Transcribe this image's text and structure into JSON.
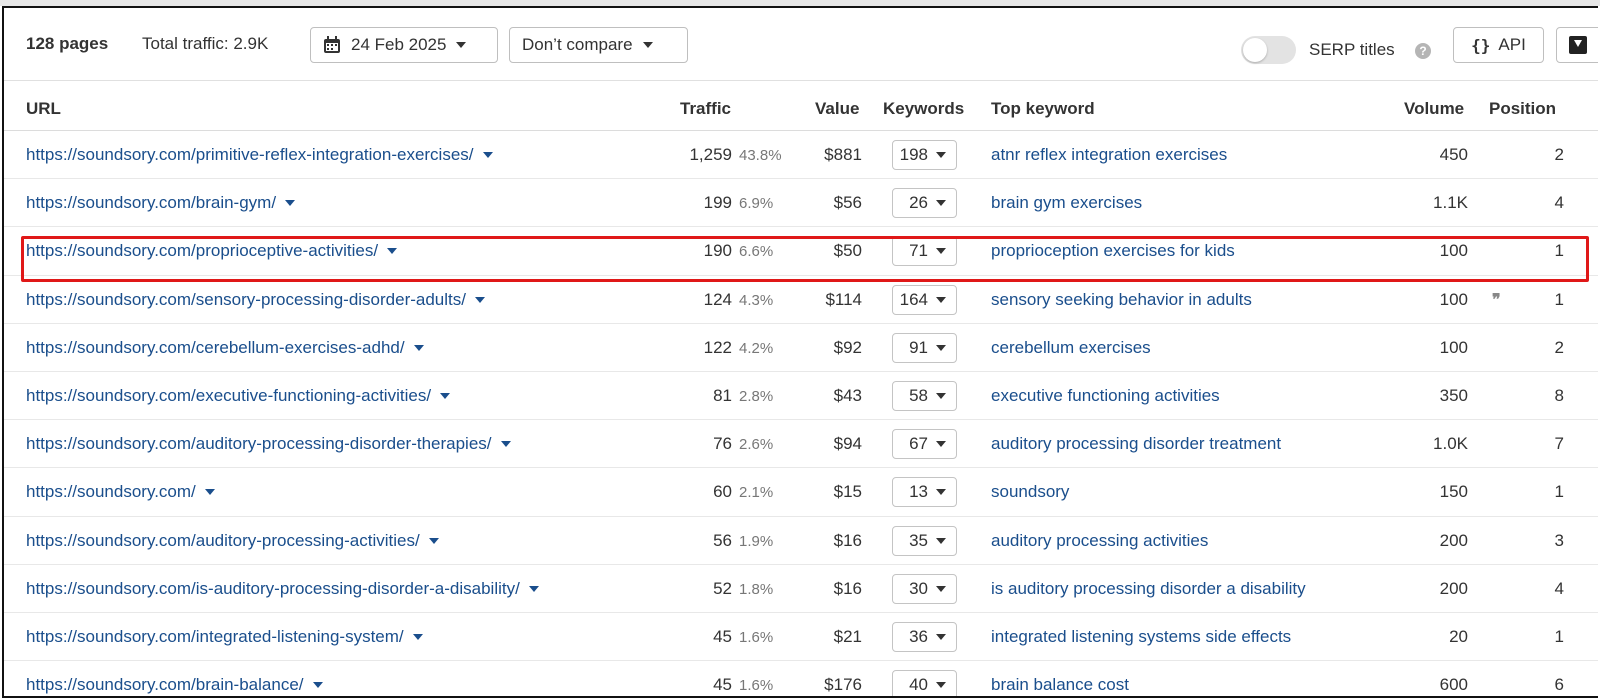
{
  "toolbar": {
    "pages": "128 pages",
    "total_traffic": "Total traffic: 2.9K",
    "date": "24 Feb 2025",
    "compare": "Don’t compare",
    "serp_titles": "SERP titles",
    "help": "?",
    "api_braces": "{}",
    "api": "API"
  },
  "columns": {
    "url": "URL",
    "traffic": "Traffic",
    "value": "Value",
    "keywords": "Keywords",
    "top_keyword": "Top keyword",
    "volume": "Volume",
    "position": "Position"
  },
  "rows": [
    {
      "url": "https://soundsory.com/primitive-reflex-integration-exercises/",
      "traffic": "1,259",
      "pct": "43.8%",
      "value": "$881",
      "keywords": "198",
      "top_keyword": "atnr reflex integration exercises",
      "volume": "450",
      "position": "2"
    },
    {
      "url": "https://soundsory.com/brain-gym/",
      "traffic": "199",
      "pct": "6.9%",
      "value": "$56",
      "keywords": "26",
      "top_keyword": "brain gym exercises",
      "volume": "1.1K",
      "position": "4"
    },
    {
      "url": "https://soundsory.com/proprioceptive-activities/",
      "traffic": "190",
      "pct": "6.6%",
      "value": "$50",
      "keywords": "71",
      "top_keyword": "proprioception exercises for kids",
      "volume": "100",
      "position": "1"
    },
    {
      "url": "https://soundsory.com/sensory-processing-disorder-adults/",
      "traffic": "124",
      "pct": "4.3%",
      "value": "$114",
      "keywords": "164",
      "top_keyword": "sensory seeking behavior in adults",
      "volume": "100",
      "position": "1",
      "quote": "❞"
    },
    {
      "url": "https://soundsory.com/cerebellum-exercises-adhd/",
      "traffic": "122",
      "pct": "4.2%",
      "value": "$92",
      "keywords": "91",
      "top_keyword": "cerebellum exercises",
      "volume": "100",
      "position": "2"
    },
    {
      "url": "https://soundsory.com/executive-functioning-activities/",
      "traffic": "81",
      "pct": "2.8%",
      "value": "$43",
      "keywords": "58",
      "top_keyword": "executive functioning activities",
      "volume": "350",
      "position": "8"
    },
    {
      "url": "https://soundsory.com/auditory-processing-disorder-therapies/",
      "traffic": "76",
      "pct": "2.6%",
      "value": "$94",
      "keywords": "67",
      "top_keyword": "auditory processing disorder treatment",
      "volume": "1.0K",
      "position": "7"
    },
    {
      "url": "https://soundsory.com/",
      "traffic": "60",
      "pct": "2.1%",
      "value": "$15",
      "keywords": "13",
      "top_keyword": "soundsory",
      "volume": "150",
      "position": "1"
    },
    {
      "url": "https://soundsory.com/auditory-processing-activities/",
      "traffic": "56",
      "pct": "1.9%",
      "value": "$16",
      "keywords": "35",
      "top_keyword": "auditory processing activities",
      "volume": "200",
      "position": "3"
    },
    {
      "url": "https://soundsory.com/is-auditory-processing-disorder-a-disability/",
      "traffic": "52",
      "pct": "1.8%",
      "value": "$16",
      "keywords": "30",
      "top_keyword": "is auditory processing disorder a disability",
      "volume": "200",
      "position": "4"
    },
    {
      "url": "https://soundsory.com/integrated-listening-system/",
      "traffic": "45",
      "pct": "1.6%",
      "value": "$21",
      "keywords": "36",
      "top_keyword": "integrated listening systems side effects",
      "volume": "20",
      "position": "1"
    },
    {
      "url": "https://soundsory.com/brain-balance/",
      "traffic": "45",
      "pct": "1.6%",
      "value": "$176",
      "keywords": "40",
      "top_keyword": "brain balance cost",
      "volume": "600",
      "position": "6"
    }
  ],
  "colors": {
    "link": "#1a4e8c",
    "highlight": "#e01818"
  }
}
